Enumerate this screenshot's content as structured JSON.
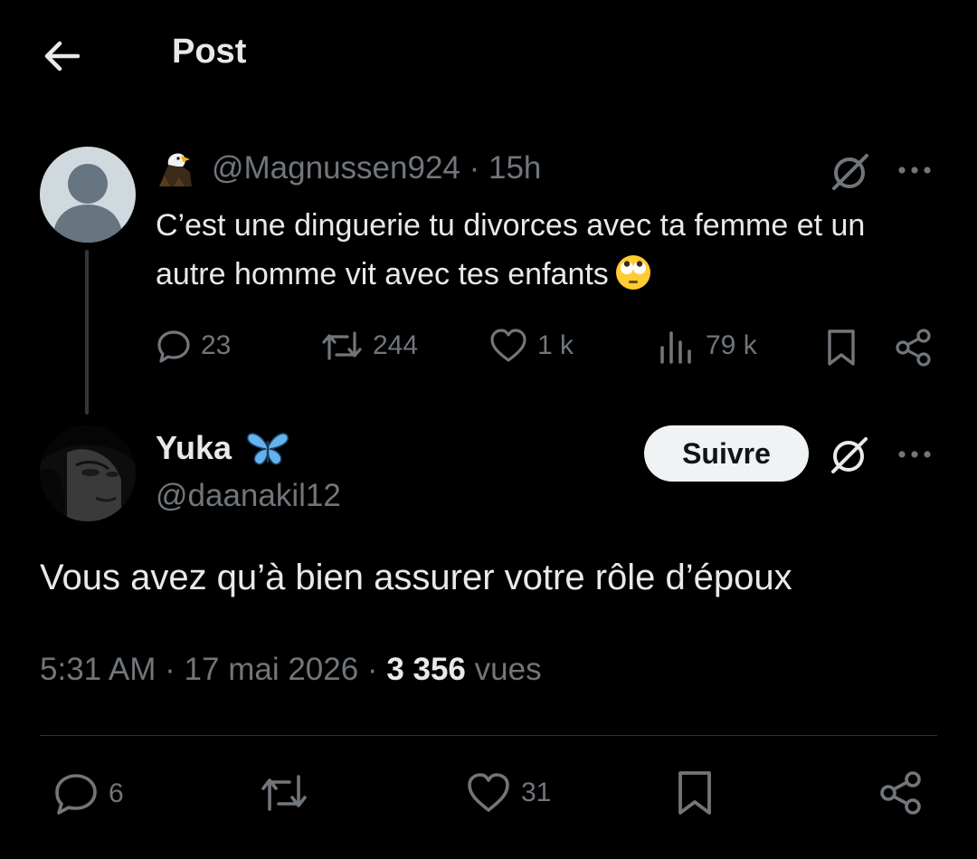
{
  "header": {
    "title": "Post",
    "back_icon": "arrow-left-icon"
  },
  "parent_post": {
    "handle": "@Magnussen924",
    "time": "15h",
    "text": "C’est une dinguerie tu divorces avec ta femme et un autre homme vit avec tes enfants",
    "emoji": "face-with-rolling-eyes",
    "stats": {
      "replies": "23",
      "reposts": "244",
      "likes": "1 k",
      "views": "79 k"
    }
  },
  "reply_post": {
    "name": "Yuka",
    "handle": "@daanakil12",
    "follow_label": "Suivre",
    "text": "Vous avez qu’à bien assurer votre rôle d’époux",
    "time": "5:31 AM",
    "date": "17 mai 2026",
    "views_count": "3 356",
    "views_label": "vues",
    "stats": {
      "replies": "6",
      "likes": "31"
    }
  },
  "colors": {
    "background": "#000000",
    "text": "#e7e9ea",
    "muted": "#71767b",
    "divider": "#2f3336",
    "butterfly": "#63b3ed"
  }
}
